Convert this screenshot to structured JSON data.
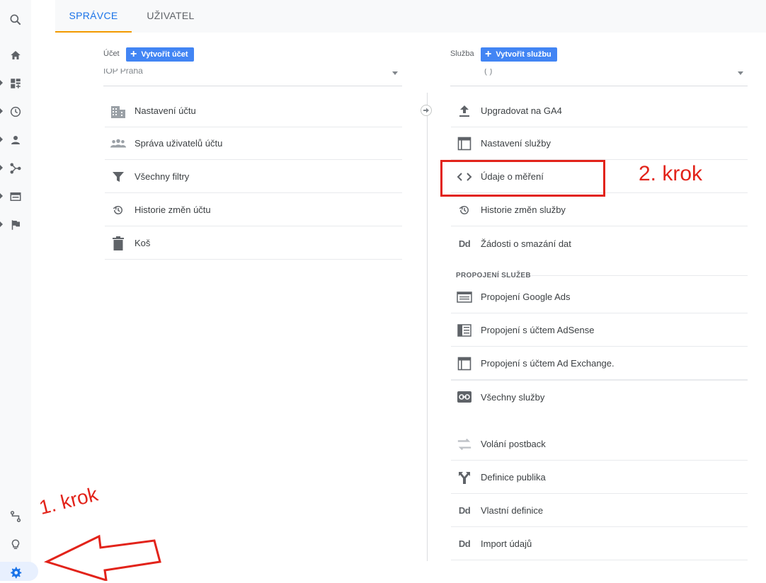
{
  "tabs": [
    {
      "label": "SPRÁVCE",
      "active": true
    },
    {
      "label": "UŽIVATEL",
      "active": false
    }
  ],
  "account": {
    "heading": "Účet",
    "create_button": "Vytvořit účet",
    "selector_value": "IOP Praha",
    "items": [
      {
        "label": "Nastavení účtu",
        "icon": "building-icon"
      },
      {
        "label": "Správa uživatelů účtu",
        "icon": "people-icon"
      },
      {
        "label": "Všechny filtry",
        "icon": "filter-icon"
      },
      {
        "label": "Historie změn účtu",
        "icon": "history-icon"
      },
      {
        "label": "Koš",
        "icon": "trash-icon"
      }
    ]
  },
  "property": {
    "heading": "Služba",
    "create_button": "Vytvořit službu",
    "selector_value": "( )",
    "items": [
      {
        "label": "Upgradovat na GA4",
        "icon": "upload-icon"
      },
      {
        "label": "Nastavení služby",
        "icon": "property-settings-icon"
      },
      {
        "label": "Údaje o měření",
        "icon": "code-icon"
      },
      {
        "label": "Historie změn služby",
        "icon": "history-icon"
      },
      {
        "label": "Žádosti o smazání dat",
        "icon": "dd-icon",
        "glyph": "Dd"
      }
    ],
    "section_label": "PROPOJENÍ SLUŽEB",
    "links": [
      {
        "label": "Propojení Google Ads",
        "icon": "google-ads-link-icon"
      },
      {
        "label": "Propojení s účtem AdSense",
        "icon": "adsense-link-icon"
      },
      {
        "label": "Propojení s účtem Ad Exchange.",
        "icon": "ad-exchange-link-icon"
      },
      {
        "label": "Všechny služby",
        "icon": "link-icon"
      }
    ],
    "extra": [
      {
        "label": "Volání postback",
        "icon": "postback-icon"
      },
      {
        "label": "Definice publika",
        "icon": "audience-icon"
      },
      {
        "label": "Vlastní definice",
        "icon": "dd-icon",
        "glyph": "Dd"
      },
      {
        "label": "Import údajů",
        "icon": "dd-icon",
        "glyph": "Dd"
      }
    ]
  },
  "annotations": {
    "step1": "1. krok",
    "step2": "2. krok",
    "color": "#e2231a"
  },
  "colors": {
    "accent": "#1a73e8",
    "tab_underline": "#f29900",
    "button": "#4285f4"
  }
}
